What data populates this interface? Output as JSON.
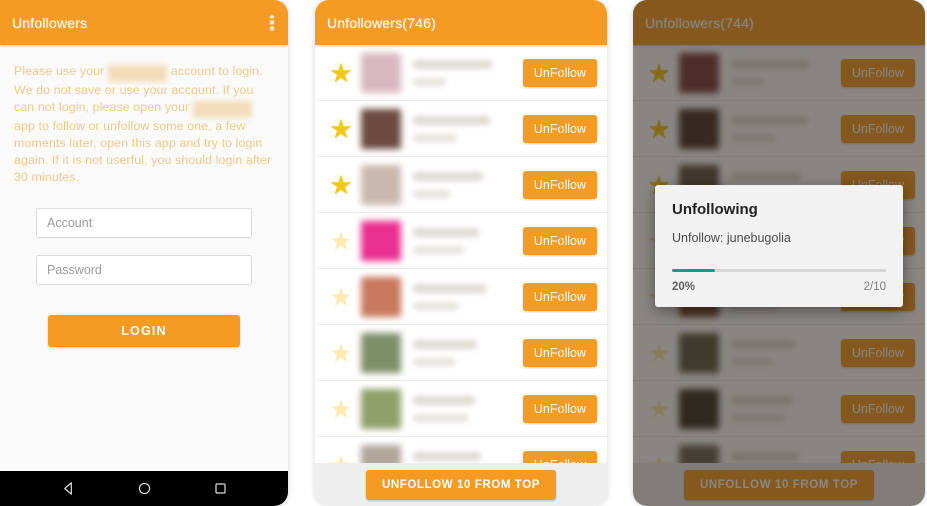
{
  "accent_color": "#f59a23",
  "progress_color": "#00a08a",
  "panel_login": {
    "appbar_title": "Unfollowers",
    "overflow_icon": "overflow-menu-icon",
    "notice_part1": "Please use your ",
    "notice_blur1": "instagram",
    "notice_part2": " account to login. We do not save or use your account. If you can not login, please open your ",
    "notice_blur2": "instagram",
    "notice_part3": " app to follow or unfollow some one, a few moments later, open this app and try to login again. If it is not userful, you should login after 30 minutes.",
    "account_placeholder": "Account",
    "password_placeholder": "Password",
    "login_label": "LOGIN",
    "nav": {
      "back_icon": "back-triangle-icon",
      "home_icon": "home-circle-icon",
      "recents_icon": "recents-square-icon"
    }
  },
  "panel_list": {
    "appbar_title": "Unfollowers(746)",
    "bulk_label": "UNFOLLOW 10 FROM TOP",
    "unfollow_label": "UnFollow",
    "rows": [
      {
        "starred": true,
        "avatar": "#d8b8c0"
      },
      {
        "starred": true,
        "avatar": "#6b4a3f"
      },
      {
        "starred": true,
        "avatar": "#c9b8ae"
      },
      {
        "starred": false,
        "avatar": "#e8308f"
      },
      {
        "starred": false,
        "avatar": "#c9795c"
      },
      {
        "starred": false,
        "avatar": "#7f8f6a"
      },
      {
        "starred": false,
        "avatar": "#8fa06a"
      },
      {
        "starred": false,
        "avatar": "#b0a79c"
      }
    ]
  },
  "panel_dialog": {
    "appbar_title": "Unfollowers(744)",
    "bulk_label": "UNFOLLOW 10 FROM TOP",
    "unfollow_label": "UnFollow",
    "rows": [
      {
        "starred": true,
        "avatar": "#7a3a40"
      },
      {
        "starred": true,
        "avatar": "#4a3228"
      },
      {
        "starred": true,
        "avatar": "#5e5044"
      },
      {
        "starred": false,
        "avatar": "#8a3560"
      },
      {
        "starred": false,
        "avatar": "#7a4a38"
      },
      {
        "starred": false,
        "avatar": "#5a5a46"
      },
      {
        "starred": false,
        "avatar": "#3a3228"
      },
      {
        "starred": false,
        "avatar": "#6a6258"
      }
    ],
    "dialog": {
      "title": "Unfollowing",
      "message": "Unfollow: junebugolia",
      "percent_label": "20%",
      "count_label": "2/10",
      "progress_value": 20
    }
  }
}
